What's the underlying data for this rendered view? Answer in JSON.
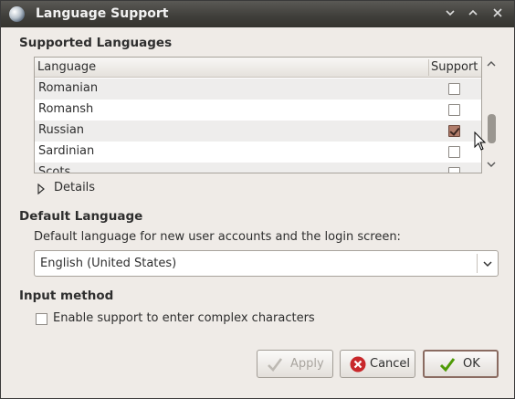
{
  "window": {
    "title": "Language Support",
    "controls": [
      "minimize",
      "maximize",
      "close"
    ]
  },
  "supported": {
    "heading": "Supported Languages",
    "columns": {
      "language": "Language",
      "support": "Support"
    },
    "rows": [
      {
        "name": "Romanian",
        "checked": false
      },
      {
        "name": "Romansh",
        "checked": false
      },
      {
        "name": "Russian",
        "checked": true
      },
      {
        "name": "Sardinian",
        "checked": false
      },
      {
        "name": "Scots",
        "checked": false
      }
    ],
    "details_label": "Details"
  },
  "default_language": {
    "heading": "Default Language",
    "description": "Default language for new user accounts and the login screen:",
    "selected": "English (United States)"
  },
  "input_method": {
    "heading": "Input method",
    "checkbox_label": "Enable support to enter complex characters",
    "checked": false
  },
  "buttons": {
    "apply": "Apply",
    "cancel": "Cancel",
    "ok": "OK"
  },
  "colors": {
    "titlebar": "#3f3e3a",
    "window_bg": "#efebe7",
    "checked_box": "#b07c6a",
    "cancel_icon": "#c8272a",
    "ok_icon": "#4e9a06"
  }
}
